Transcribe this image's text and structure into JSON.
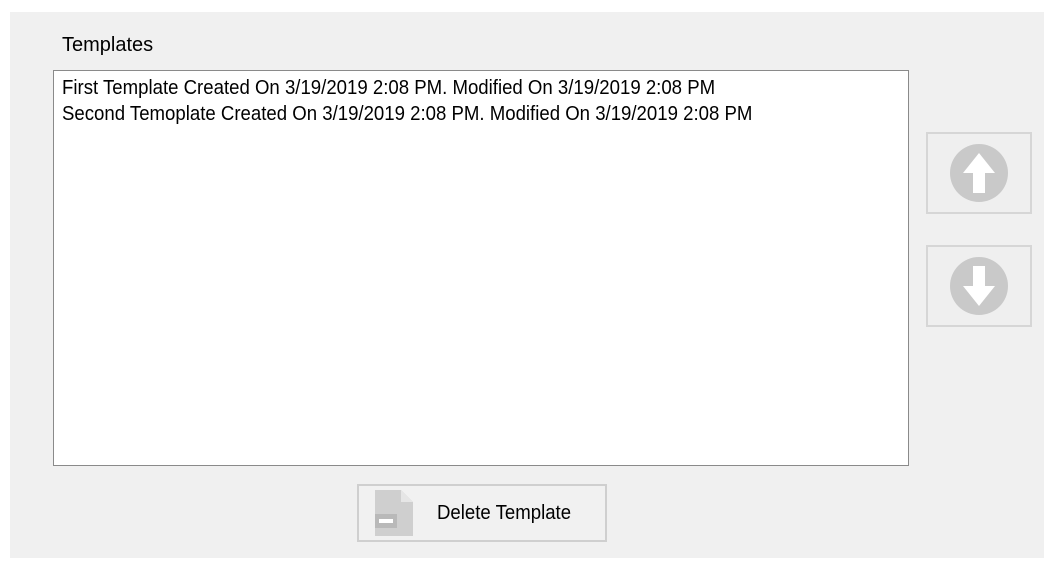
{
  "group": {
    "label": "Templates"
  },
  "templates_list": {
    "items": [
      "First Template Created On 3/19/2019 2:08 PM. Modified On 3/19/2019 2:08 PM",
      "Second Temoplate Created On 3/19/2019 2:08 PM. Modified On 3/19/2019 2:08 PM"
    ]
  },
  "buttons": {
    "move_up_icon": "arrow-up-circle-icon",
    "move_down_icon": "arrow-down-circle-icon",
    "delete_label": "Delete Template",
    "delete_icon": "document-delete-icon"
  },
  "colors": {
    "panel_background": "#f0f0f0",
    "list_background": "#ffffff",
    "disabled_icon": "#c8c8c8"
  }
}
